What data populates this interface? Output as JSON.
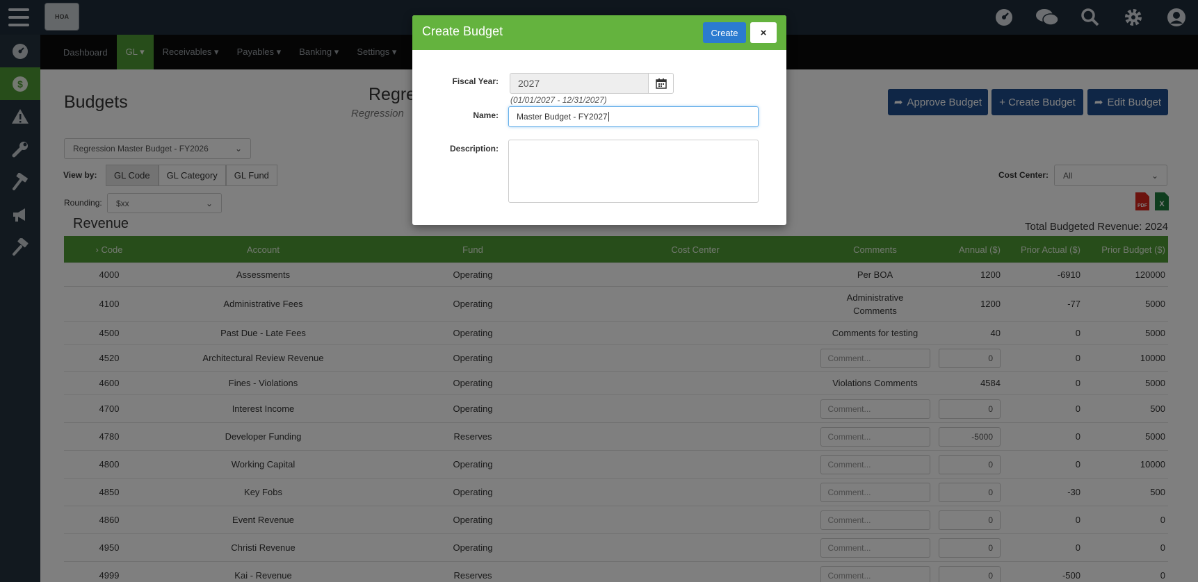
{
  "topbar": {
    "logo_text": "HOA",
    "icons": [
      "dashboard-icon",
      "chat-icon",
      "search-icon",
      "gear-icon",
      "user-icon"
    ]
  },
  "sidebar": {
    "items": [
      "dashboard-icon",
      "dollar-icon",
      "warning-icon",
      "wrench-icon",
      "hammer-icon",
      "megaphone-icon",
      "gavel-icon"
    ]
  },
  "nav": {
    "items": [
      "Dashboard",
      "GL ▾",
      "Receivables ▾",
      "Payables ▾",
      "Banking ▾",
      "Settings ▾"
    ]
  },
  "page": {
    "title": "Budgets",
    "center_title": "Regre",
    "center_subtitle": "Regression",
    "approve_label": "Approve Budget",
    "create_label": "+ Create Budget",
    "edit_label": "Edit Budget",
    "budget_select": "Regression Master Budget - FY2026",
    "viewby_label": "View by:",
    "viewby_options": [
      "GL Code",
      "GL Category",
      "GL Fund"
    ],
    "rounding_label": "Rounding:",
    "rounding_value": "$xx",
    "cost_center_label": "Cost Center:",
    "cost_center_value": "All",
    "section_title": "Revenue",
    "total_label": "Total Budgeted Revenue: 2024"
  },
  "table": {
    "headers": {
      "code": "Code",
      "account": "Account",
      "fund": "Fund",
      "cost_center": "Cost Center",
      "comments": "Comments",
      "annual": "Annual ($)",
      "prior_actual": "Prior Actual ($)",
      "prior_budget": "Prior Budget ($)"
    },
    "comment_placeholder": "Comment...",
    "rows": [
      {
        "code": "4000",
        "account": "Assessments",
        "fund": "Operating",
        "comment": "Per BOA",
        "annual": "1200",
        "prior_actual": "-6910",
        "prior_budget": "120000"
      },
      {
        "code": "4100",
        "account": "Administrative Fees",
        "fund": "Operating",
        "comment": "Administrative Comments",
        "annual": "1200",
        "prior_actual": "-77",
        "prior_budget": "5000"
      },
      {
        "code": "4500",
        "account": "Past Due - Late Fees",
        "fund": "Operating",
        "comment": "Comments for testing",
        "annual": "40",
        "prior_actual": "0",
        "prior_budget": "5000"
      },
      {
        "code": "4520",
        "account": "Architectural Review Revenue",
        "fund": "Operating",
        "comment": "",
        "annual": "0",
        "prior_actual": "0",
        "prior_budget": "10000"
      },
      {
        "code": "4600",
        "account": "Fines - Violations",
        "fund": "Operating",
        "comment": "Violations Comments",
        "annual": "4584",
        "prior_actual": "0",
        "prior_budget": "5000"
      },
      {
        "code": "4700",
        "account": "Interest Income",
        "fund": "Operating",
        "comment": "",
        "annual": "0",
        "prior_actual": "0",
        "prior_budget": "500"
      },
      {
        "code": "4780",
        "account": "Developer Funding",
        "fund": "Reserves",
        "comment": "",
        "annual": "-5000",
        "prior_actual": "0",
        "prior_budget": "5000"
      },
      {
        "code": "4800",
        "account": "Working Capital",
        "fund": "Operating",
        "comment": "",
        "annual": "0",
        "prior_actual": "0",
        "prior_budget": "10000"
      },
      {
        "code": "4850",
        "account": "Key Fobs",
        "fund": "Operating",
        "comment": "",
        "annual": "0",
        "prior_actual": "-30",
        "prior_budget": "500"
      },
      {
        "code": "4860",
        "account": "Event Revenue",
        "fund": "Operating",
        "comment": "",
        "annual": "0",
        "prior_actual": "0",
        "prior_budget": "0"
      },
      {
        "code": "4950",
        "account": "Christi Revenue",
        "fund": "Operating",
        "comment": "",
        "annual": "0",
        "prior_actual": "0",
        "prior_budget": "0"
      },
      {
        "code": "4999",
        "account": "Kai - Revenue",
        "fund": "Reserves",
        "comment": "",
        "annual": "0",
        "prior_actual": "-500",
        "prior_budget": "0"
      }
    ]
  },
  "modal": {
    "title": "Create Budget",
    "create_label": "Create",
    "close_label": "×",
    "fiscal_year_label": "Fiscal Year:",
    "fiscal_year_value": "2027",
    "fiscal_year_range": "(01/01/2027 - 12/31/2027)",
    "name_label": "Name:",
    "name_value": "Master Budget - FY2027",
    "description_label": "Description:"
  },
  "colors": {
    "topbar": "#1f2d3a",
    "accent_green": "#4f9a35",
    "modal_header": "#64b33e",
    "primary_blue": "#1e4d8c",
    "create_blue": "#2b7bd0"
  }
}
